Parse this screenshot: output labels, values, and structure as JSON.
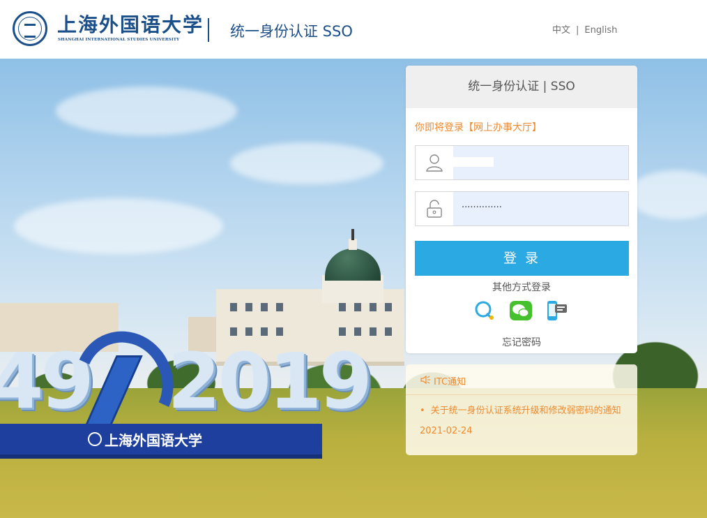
{
  "header": {
    "logo_cn": "上海外国语大学",
    "logo_en": "SHANGHAI INTERNATIONAL STUDIES UNIVERSITY",
    "system_title": "统一身份认证 SSO",
    "lang_zh": "中文",
    "lang_sep": "|",
    "lang_en": "English"
  },
  "scene": {
    "monument_left": "49",
    "monument_right": "2019",
    "plinth_text": "上海外国语大学"
  },
  "login": {
    "panel_title": "统一身份认证 | SSO",
    "notice": "你即将登录【网上办事大厅】",
    "username_value": "",
    "password_value": "··············",
    "login_button": "登 录",
    "other_methods": "其他方式登录",
    "forgot_password": "忘记密码",
    "social_icons": [
      "qq-icon",
      "wechat-icon",
      "phone-sms-icon"
    ]
  },
  "itc": {
    "title": "ITC通知",
    "items": [
      {
        "bullet": "•",
        "text": "关于统一身份认证系统升级和修改弱密码的通知",
        "date": "2021-02-24"
      }
    ]
  },
  "colors": {
    "brand_blue": "#1b4f8a",
    "accent_orange": "#f0892c",
    "login_button": "#2ba9e3"
  }
}
